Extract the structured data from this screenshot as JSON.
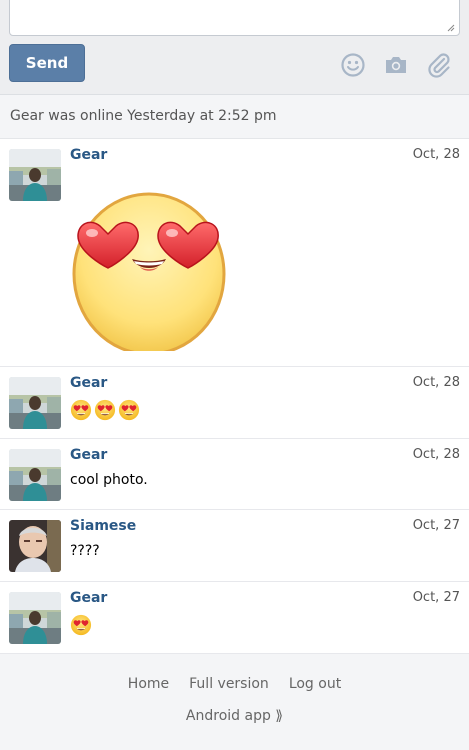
{
  "compose": {
    "message_value": "",
    "send_label": "Send",
    "icons": [
      "smiley-icon",
      "camera-icon",
      "paperclip-icon"
    ]
  },
  "status": {
    "text": "Gear was online Yesterday at 2:52 pm"
  },
  "messages": [
    {
      "author": "Gear",
      "date": "Oct, 28",
      "type": "sticker",
      "sticker": "heart-eyes-sticker"
    },
    {
      "author": "Gear",
      "date": "Oct, 28",
      "type": "emoji",
      "emoji": [
        "heart-eyes",
        "heart-eyes",
        "heart-eyes"
      ]
    },
    {
      "author": "Gear",
      "date": "Oct, 28",
      "type": "text",
      "text": "cool photo."
    },
    {
      "author": "Siamese",
      "date": "Oct, 27",
      "type": "text",
      "text": "????"
    },
    {
      "author": "Gear",
      "date": "Oct, 27",
      "type": "emoji",
      "emoji": [
        "heart-eyes"
      ]
    }
  ],
  "footer": {
    "links": [
      "Home",
      "Full version",
      "Log out"
    ],
    "android_label": "Android app ⟫"
  },
  "colors": {
    "accent": "#5b7fa8",
    "author": "#2a5885",
    "compose_bg": "#edeef0",
    "footer_bg": "#f4f5f7"
  }
}
